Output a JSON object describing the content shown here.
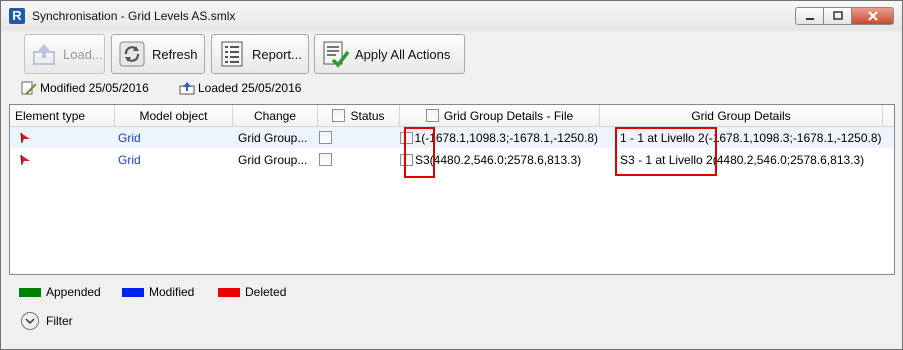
{
  "window": {
    "title": "Synchronisation - Grid Levels AS.smlx",
    "app_icon_letter": "R",
    "controls": [
      "minimize",
      "maximize",
      "close"
    ]
  },
  "toolbar": {
    "load_label": "Load...",
    "load_enabled": false,
    "refresh_label": "Refresh",
    "report_label": "Report...",
    "apply_label": "Apply All Actions"
  },
  "info": {
    "modified": "Modified 25/05/2016",
    "loaded": "Loaded 25/05/2016"
  },
  "table": {
    "columns": [
      "Element type",
      "Model object",
      "Change",
      "Status",
      "Grid Group Details - File",
      "Grid Group Details"
    ],
    "rows": [
      {
        "element_icon": "red-flag-icon",
        "model_object": "Grid",
        "change": "Grid Group...",
        "status_checked": false,
        "file_details": "1(-1678.1,1098.3;-1678.1,-1250.8)",
        "details": "1 - 1 at Livello 2(-1678.1,1098.3;-1678.1,-1250.8)"
      },
      {
        "element_icon": "red-flag-icon",
        "model_object": "Grid",
        "change": "Grid Group...",
        "status_checked": false,
        "file_details": "S3(4480.2,546.0;2578.6,813.3)",
        "details": "S3 - 1 at Livello 2(4480.2,546.0;2578.6,813.3)"
      }
    ]
  },
  "legend": {
    "appended_label": "Appended",
    "appended_color": "#008000",
    "modified_label": "Modified",
    "modified_color": "#0022ee",
    "deleted_label": "Deleted",
    "deleted_color": "#ee0000"
  },
  "filter": {
    "label": "Filter"
  }
}
